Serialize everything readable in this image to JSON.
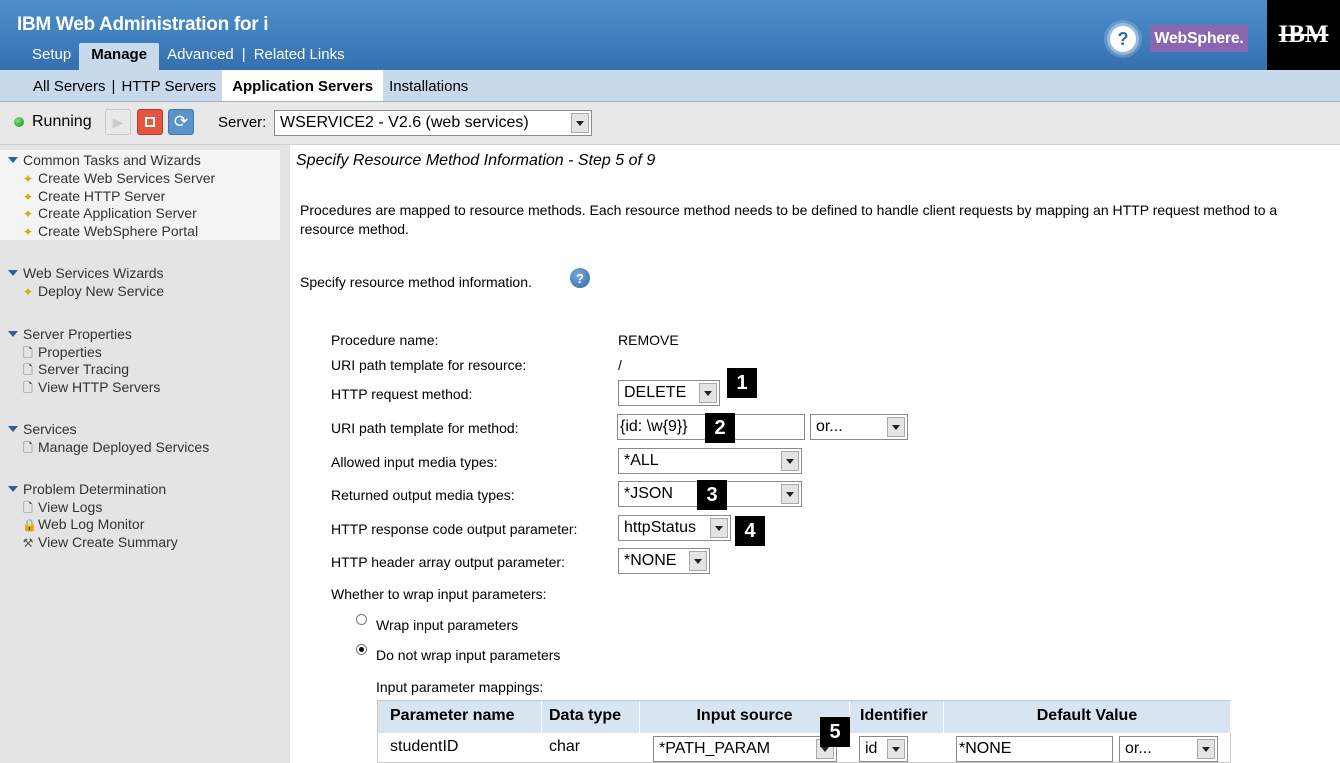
{
  "header": {
    "app_title": "IBM Web Administration for i",
    "tabs": [
      "Setup",
      "Manage",
      "Advanced",
      "Related Links"
    ],
    "active_tab": "Manage",
    "help_glyph": "?",
    "brand_badge": "WebSphere.",
    "logo_text": "IBM"
  },
  "subtabs": {
    "items": [
      "All Servers",
      "HTTP Servers",
      "Application Servers",
      "Installations"
    ],
    "active": "Application Servers"
  },
  "status": {
    "state": "Running",
    "state_color": "#22a022",
    "server_label": "Server:",
    "server_value": "WSERVICE2 - V2.6 (web services)"
  },
  "sidebar": {
    "groups": [
      {
        "title": "Common Tasks and Wizards",
        "items": [
          "Create Web Services Server",
          "Create HTTP Server",
          "Create Application Server",
          "Create WebSphere Portal"
        ]
      },
      {
        "title": "Web Services Wizards",
        "items": [
          "Deploy New Service"
        ]
      },
      {
        "title": "Server Properties",
        "items": [
          "Properties",
          "Server Tracing",
          "View HTTP Servers"
        ]
      },
      {
        "title": "Services",
        "items": [
          "Manage Deployed Services"
        ]
      },
      {
        "title": "Problem Determination",
        "items": [
          "View Logs",
          "Web Log Monitor",
          "View Create Summary"
        ]
      }
    ]
  },
  "main": {
    "title": "Specify Resource Method Information - Step 5 of 9",
    "description": "Procedures are mapped to resource methods. Each resource method needs to be defined to handle client requests by mapping an HTTP request method to a resource method.",
    "specify_label": "Specify resource method information.",
    "form": {
      "procedure_name_label": "Procedure name:",
      "procedure_name_value": "REMOVE",
      "uri_resource_label": "URI path template for resource:",
      "uri_resource_value": "/",
      "http_method_label": "HTTP request method:",
      "http_method_value": "DELETE",
      "uri_method_label": "URI path template for method:",
      "uri_method_value": "{id: \\w{9}}",
      "uri_method_option": "or...",
      "input_media_label": "Allowed input media types:",
      "input_media_value": "*ALL",
      "output_media_label": "Returned output media types:",
      "output_media_value": "*JSON",
      "resp_code_label": "HTTP response code output parameter:",
      "resp_code_value": "httpStatus",
      "header_array_label": "HTTP header array output parameter:",
      "header_array_value": "*NONE",
      "wrap_label": "Whether to wrap input parameters:",
      "wrap_option": "Wrap input parameters",
      "nowrap_option": "Do not wrap input parameters",
      "selected_wrap": "Do not wrap input parameters"
    },
    "callouts": [
      "1",
      "2",
      "3",
      "4",
      "5"
    ],
    "mappings": {
      "label": "Input parameter mappings:",
      "headers": [
        "Parameter name",
        "Data type",
        "Input source",
        "Identifier",
        "Default Value"
      ],
      "rows": [
        {
          "name": "studentID",
          "type": "char",
          "source": "*PATH_PARAM",
          "identifier": "id",
          "default": "*NONE",
          "default_option": "or..."
        }
      ]
    }
  }
}
